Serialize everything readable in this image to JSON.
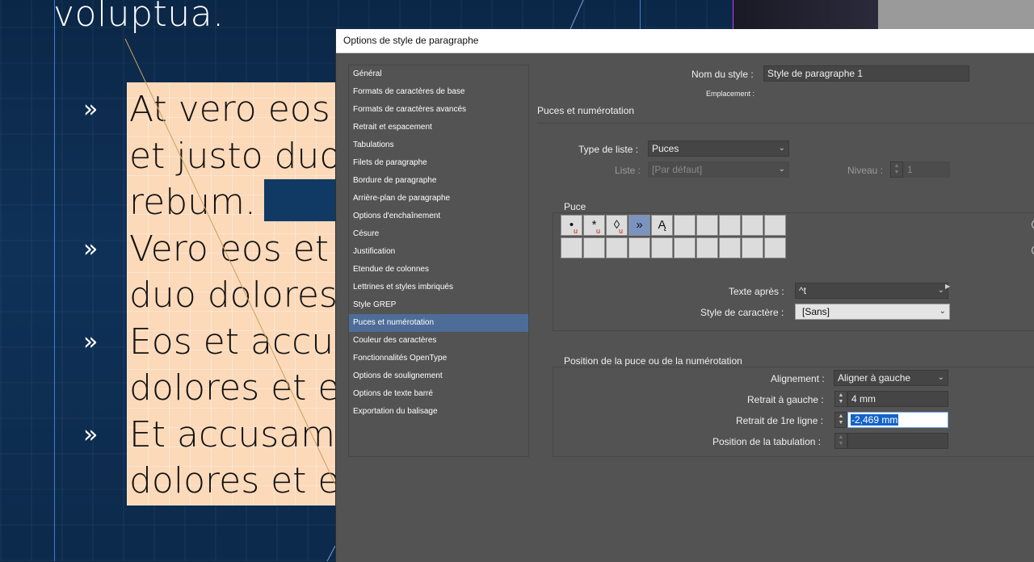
{
  "document": {
    "heading": "voluptua.",
    "bullet_glyph": "»",
    "paragraph_lines": [
      "At vero eos",
      "et justo duo",
      "rebum.",
      "Vero eos et",
      "duo dolores",
      "Eos et accus",
      "dolores et e",
      "Et accusam",
      "dolores et e"
    ]
  },
  "dialog": {
    "title": "Options de style de paragraphe",
    "categories": [
      "Général",
      "Formats de caractères de base",
      "Formats de caractères avancés",
      "Retrait et espacement",
      "Tabulations",
      "Filets de paragraphe",
      "Bordure de paragraphe",
      "Arrière-plan de paragraphe",
      "Options d'enchaînement",
      "Césure",
      "Justification",
      "Etendue de colonnes",
      "Lettrines et styles imbriqués",
      "Style GREP",
      "Puces et numérotation",
      "Couleur des caractères",
      "Fonctionnalités OpenType",
      "Options de soulignement",
      "Options de texte barré",
      "Exportation du balisage"
    ],
    "selected_category": "Puces et numérotation",
    "style_name_label": "Nom du style :",
    "style_name_value": "Style de paragraphe 1",
    "location_label": "Emplacement :",
    "section_title": "Puces et numérotation",
    "list_type_label": "Type de liste :",
    "list_type_value": "Puces",
    "list_label": "Liste :",
    "list_value": "[Par défaut]",
    "level_label": "Niveau :",
    "level_value": "1",
    "bullet_group_title": "Puce",
    "bullet_chars": [
      {
        "glyph": "•",
        "sub": "u"
      },
      {
        "glyph": "*",
        "sub": "u"
      },
      {
        "glyph": "◊",
        "sub": "u"
      },
      {
        "glyph": "»",
        "sub": ""
      },
      {
        "glyph": "Ą",
        "sub": ""
      }
    ],
    "selected_bullet": "»",
    "text_after_label": "Texte après :",
    "text_after_value": "^t",
    "char_style_label": "Style de caractère :",
    "char_style_value": "[Sans]",
    "position_group_title": "Position de la puce ou de la numérotation",
    "alignment_label": "Alignement :",
    "alignment_value": "Aligner à gauche",
    "left_indent_label": "Retrait à gauche :",
    "left_indent_value": "4 mm",
    "first_line_indent_label": "Retrait de 1re ligne :",
    "first_line_indent_value": "-2,469 mm",
    "tab_position_label": "Position de la tabulation :",
    "tab_position_value": ""
  },
  "icons": {
    "chevron": "chevron-down-icon",
    "stepper": "stepper-icon",
    "flyout": "flyout-arrow-icon"
  },
  "colors": {
    "dialog_bg": "#535353",
    "selection": "#4e6c98",
    "bullet_selected": "#7b94bf",
    "text_selection": "#1463c7",
    "frame_fill": "#fbd9b9",
    "document_bg": "#0d2a48"
  }
}
